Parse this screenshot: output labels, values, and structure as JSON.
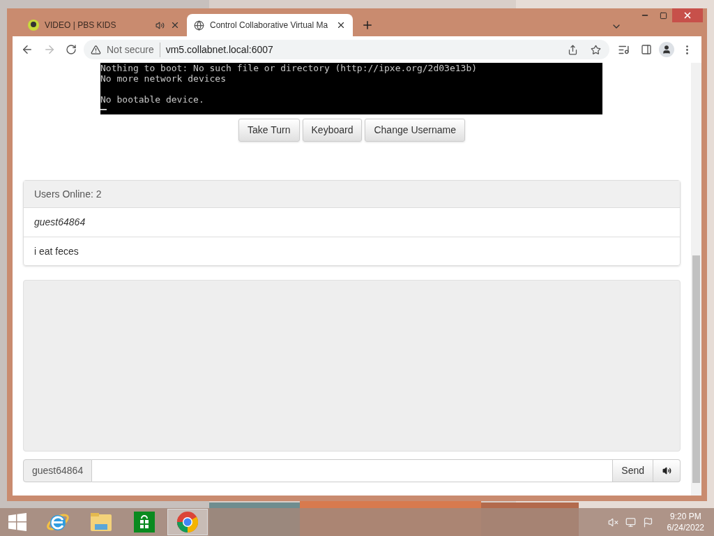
{
  "browser": {
    "tabs": [
      {
        "title": "VIDEO | PBS KIDS",
        "selected": false,
        "audio": true
      },
      {
        "title": "Control Collaborative Virtual Ma",
        "selected": true,
        "audio": false
      }
    ],
    "security": "Not secure",
    "url": "vm5.collabnet.local:6007"
  },
  "page": {
    "terminal_paragraphs": [
      [
        "Nothing to boot: No such file or directory (http://ipxe.org/2d03e13b)",
        "No more network devices"
      ],
      [
        "No bootable device."
      ]
    ],
    "buttons": [
      "Take Turn",
      "Keyboard",
      "Change Username"
    ],
    "users": {
      "header": "Users Online: 2",
      "list": [
        {
          "name": "guest64864",
          "self": true
        },
        {
          "name": "i eat feces",
          "self": false
        }
      ]
    },
    "chat": {
      "username": "guest64864",
      "send": "Send"
    }
  },
  "taskbar": {
    "apps": [
      {
        "kind": "ie",
        "selected": false
      },
      {
        "kind": "explorer",
        "selected": false
      },
      {
        "kind": "store",
        "selected": false
      },
      {
        "kind": "chrome",
        "selected": true
      }
    ],
    "time": "9:20 PM",
    "date": "6/24/2022"
  }
}
